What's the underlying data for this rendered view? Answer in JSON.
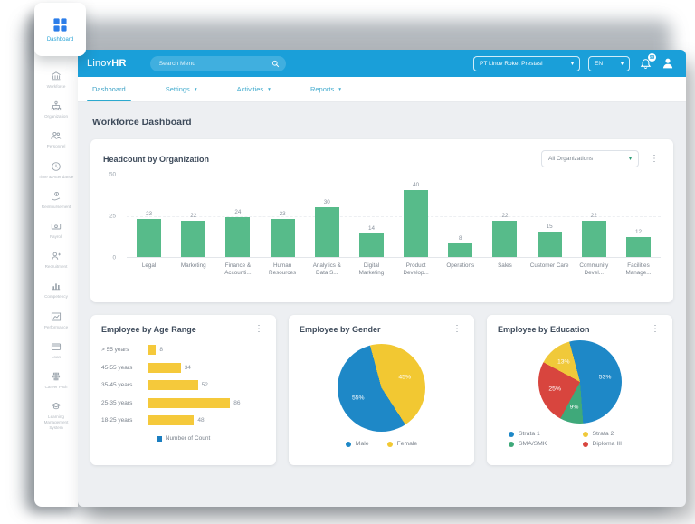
{
  "topbar": {
    "logo_prefix": "Linov",
    "logo_bold": "HR",
    "search_placeholder": "Search Menu",
    "company_selector": "PT Linov Roket Prestasi",
    "language_selector": "EN",
    "notification_count": "99"
  },
  "nav": {
    "tabs": [
      {
        "label": "Dashboard",
        "active": true,
        "dropdown": false
      },
      {
        "label": "Settings",
        "active": false,
        "dropdown": true
      },
      {
        "label": "Activities",
        "active": false,
        "dropdown": true
      },
      {
        "label": "Reports",
        "active": false,
        "dropdown": true
      }
    ]
  },
  "sidebar": {
    "active_item": {
      "label": "Dashboard",
      "icon": "dashboard-grid-icon"
    },
    "items": [
      {
        "label": "Workforce",
        "icon": "building-icon"
      },
      {
        "label": "Organization",
        "icon": "org-chart-icon"
      },
      {
        "label": "Personnel",
        "icon": "users-icon"
      },
      {
        "label": "Time & Attendance",
        "icon": "clock-icon"
      },
      {
        "label": "Reimbursement",
        "icon": "hand-money-icon"
      },
      {
        "label": "Payroll",
        "icon": "banknote-icon"
      },
      {
        "label": "Recruitment",
        "icon": "user-plus-icon"
      },
      {
        "label": "Competency",
        "icon": "bar-chart-icon"
      },
      {
        "label": "Performance",
        "icon": "line-chart-icon"
      },
      {
        "label": "Loan",
        "icon": "credit-card-icon"
      },
      {
        "label": "Career Path",
        "icon": "career-path-icon"
      },
      {
        "label": "Learning Management System",
        "icon": "graduation-cap-icon"
      }
    ]
  },
  "page": {
    "title": "Workforce Dashboard"
  },
  "chart_data": [
    {
      "id": "headcount",
      "type": "bar",
      "title": "Headcount by Organization",
      "filter": {
        "selected": "All Organizations"
      },
      "categories": [
        "Legal",
        "Marketing",
        "Finance & Accounti...",
        "Human Resources",
        "Analytics & Data S...",
        "Digital Marketing",
        "Product Develop...",
        "Operations",
        "Sales",
        "Customer Care",
        "Community Devel...",
        "Facilities Manage..."
      ],
      "values": [
        23,
        22,
        24,
        23,
        30,
        14,
        40,
        8,
        22,
        15,
        22,
        12
      ],
      "ylim": [
        0,
        50
      ],
      "yticks": [
        0,
        25,
        50
      ],
      "bar_color": "#57BB8A",
      "grid": true
    },
    {
      "id": "age_range",
      "type": "bar",
      "orientation": "horizontal",
      "title": "Employee by Age Range",
      "categories": [
        "> 55 years",
        "45-55 years",
        "35-45 years",
        "25-35 years",
        "18-25 years"
      ],
      "values": [
        8,
        34,
        52,
        86,
        48
      ],
      "xlim": [
        0,
        100
      ],
      "bar_color": "#F5C93B",
      "legend": [
        {
          "label": "Number of Count",
          "color": "#1B7EC0"
        }
      ]
    },
    {
      "id": "gender",
      "type": "pie",
      "title": "Employee by Gender",
      "start_angle_deg": -15,
      "slices": [
        {
          "label": "Female",
          "value_pct": 45,
          "color": "#F2C832"
        },
        {
          "label": "Male",
          "value_pct": 55,
          "color": "#1E88C7"
        }
      ],
      "legend_order": [
        "Male",
        "Female"
      ],
      "legend_position": "bottom"
    },
    {
      "id": "education",
      "type": "pie",
      "title": "Employee by Education",
      "start_angle_deg": -15,
      "slices": [
        {
          "label": "Strata 1",
          "value_pct": 53,
          "color": "#1E88C7"
        },
        {
          "label": "SMA/SMK",
          "value_pct": 9,
          "color": "#3FA97A"
        },
        {
          "label": "Diploma III",
          "value_pct": 25,
          "color": "#D8453E"
        },
        {
          "label": "Strata 2",
          "value_pct": 13,
          "color": "#F0C93A"
        }
      ],
      "legend_order": [
        "Strata 1",
        "Strata 2",
        "SMA/SMK",
        "Diploma III"
      ],
      "legend_position": "bottom"
    }
  ],
  "colors": {
    "header_blue": "#1A9FD9",
    "nav_link": "#45ADCF",
    "content_bg": "#EDEFF2",
    "text_dark": "#3E4B5B",
    "text_gray": "#7A828C",
    "bar_green": "#57BB8A",
    "bar_yellow": "#F5C93B",
    "pie_blue": "#1E88C7",
    "pie_yellow": "#F2C832",
    "pie_red": "#D8453E",
    "pie_green": "#3FA97A",
    "select_caret": "#2E9E77"
  }
}
